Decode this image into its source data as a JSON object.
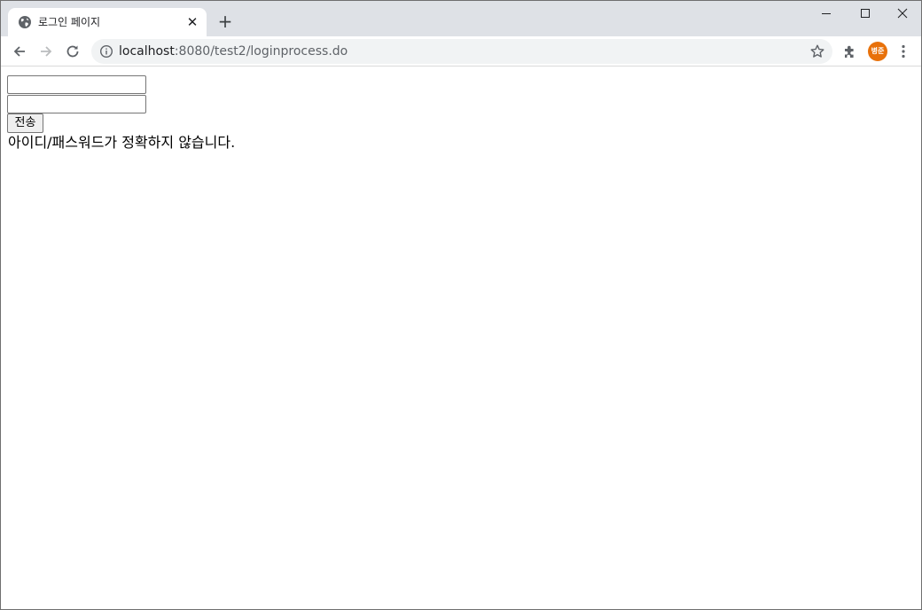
{
  "browser": {
    "tab": {
      "title": "로그인 페이지",
      "close_symbol": "✕",
      "favicon": "globe-icon"
    },
    "new_tab_symbol": "+",
    "address": {
      "host": "localhost",
      "path": ":8080/test2/loginprocess.do"
    },
    "profile": {
      "initials": "병준",
      "color": "#e8710a"
    },
    "icons": [
      "back-arrow-icon",
      "forward-arrow-icon",
      "reload-icon",
      "info-icon",
      "star-icon",
      "puzzle-icon",
      "kebab-menu-icon",
      "minimize-icon",
      "maximize-icon",
      "close-icon"
    ]
  },
  "page": {
    "username_value": "",
    "password_value": "",
    "submit_label": "전송",
    "error_message": "아이디/패스워드가 정확하지 않습니다."
  }
}
